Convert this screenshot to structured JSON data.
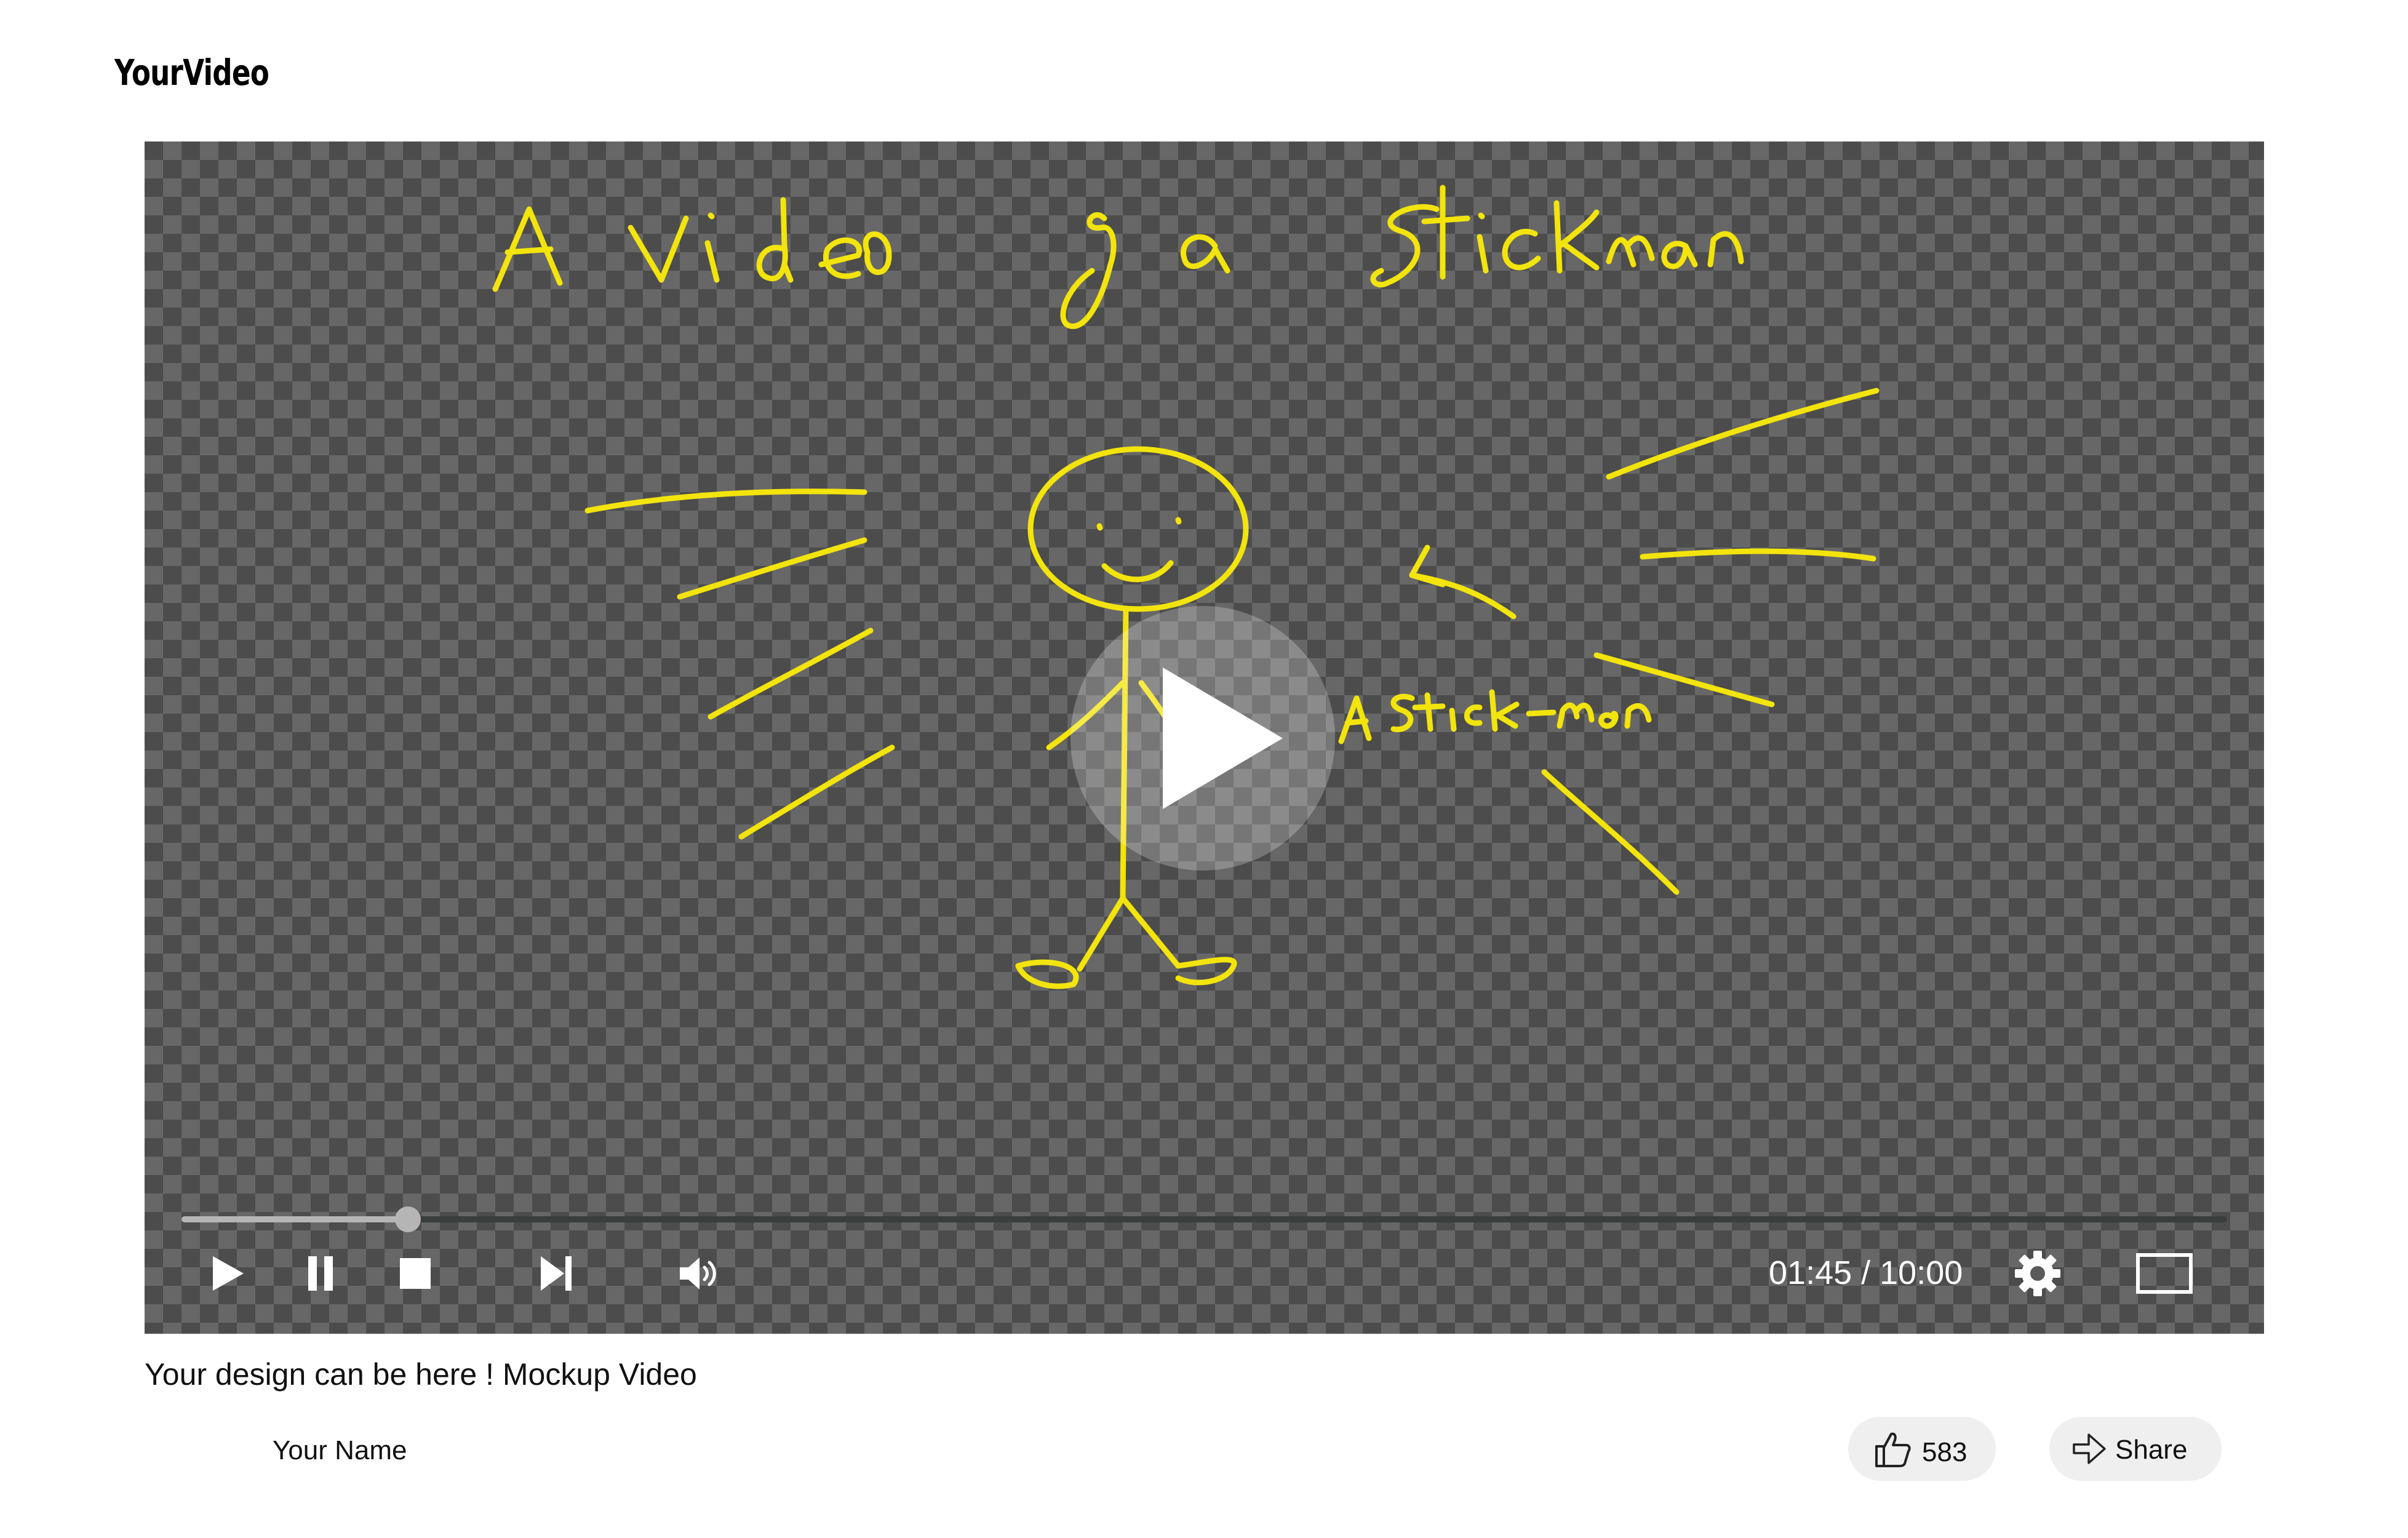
{
  "app": {
    "logo": "YourVideo"
  },
  "player": {
    "time_display": "01:45 / 10:00",
    "progress_fraction": 0.1107,
    "accent_color": "#f2e40c",
    "drawing_texts": [
      "A video of a stickman",
      "A stickman"
    ],
    "controls": [
      "play-icon",
      "pause-icon",
      "stop-icon",
      "skip-next-icon",
      "volume-icon",
      "gear-icon",
      "fullscreen-icon"
    ]
  },
  "video": {
    "title": "Your design can be here ! Mockup Video",
    "channel": "Your Name",
    "like_count": "583",
    "share_label": "Share"
  }
}
